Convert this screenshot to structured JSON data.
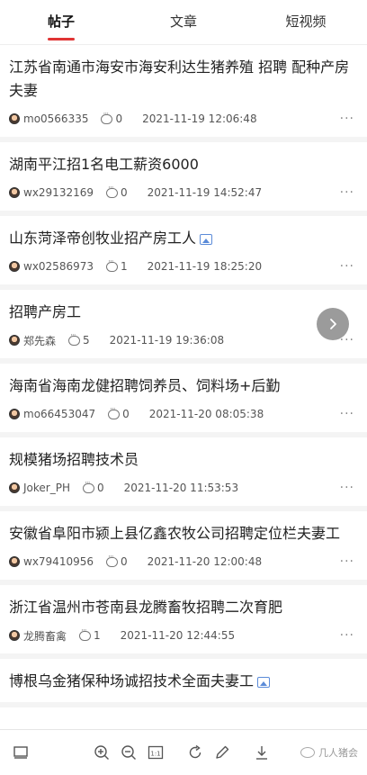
{
  "tabs": [
    {
      "label": "帖子",
      "active": true
    },
    {
      "label": "文章",
      "active": false
    },
    {
      "label": "短视频",
      "active": false
    }
  ],
  "posts": [
    {
      "title": "江苏省南通市海安市海安利达生猪养殖 招聘 配种产房夫妻",
      "author": "mo0566335",
      "comments": "0",
      "time": "2021-11-19 12:06:48",
      "has_image": false
    },
    {
      "title": "湖南平江招1名电工薪资6000",
      "author": "wx29132169",
      "comments": "0",
      "time": "2021-11-19 14:52:47",
      "has_image": false
    },
    {
      "title": "山东菏泽帝创牧业招产房工人",
      "author": "wx02586973",
      "comments": "1",
      "time": "2021-11-19 18:25:20",
      "has_image": true
    },
    {
      "title": "招聘产房工",
      "author": "郑先森",
      "comments": "5",
      "time": "2021-11-19 19:36:08",
      "has_image": false
    },
    {
      "title": "海南省海南龙健招聘饲养员、饲料场+后勤",
      "author": "mo66453047",
      "comments": "0",
      "time": "2021-11-20 08:05:38",
      "has_image": false
    },
    {
      "title": "规模猪场招聘技术员",
      "author": "Joker_PH",
      "comments": "0",
      "time": "2021-11-20 11:53:53",
      "has_image": false
    },
    {
      "title": "安徽省阜阳市颍上县亿鑫农牧公司招聘定位栏夫妻工",
      "author": "wx79410956",
      "comments": "0",
      "time": "2021-11-20 12:00:48",
      "has_image": false
    },
    {
      "title": "浙江省温州市苍南县龙腾畜牧招聘二次育肥",
      "author": "龙腾畜禽",
      "comments": "1",
      "time": "2021-11-20 12:44:55",
      "has_image": false
    },
    {
      "title": "博根乌金猪保种场诚招技术全面夫妻工",
      "author": "",
      "comments": "",
      "time": "",
      "has_image": true
    }
  ],
  "more_label": "···",
  "toolbar": {
    "zoom_reset_label": "1:1",
    "watermark": "几人猪会"
  },
  "icons": {
    "float": "chevron-right-icon",
    "toolbar": [
      "screen-icon",
      "zoom-in-icon",
      "zoom-out-icon",
      "actual-size-icon",
      "rotate-icon",
      "pen-icon",
      "download-icon"
    ]
  }
}
